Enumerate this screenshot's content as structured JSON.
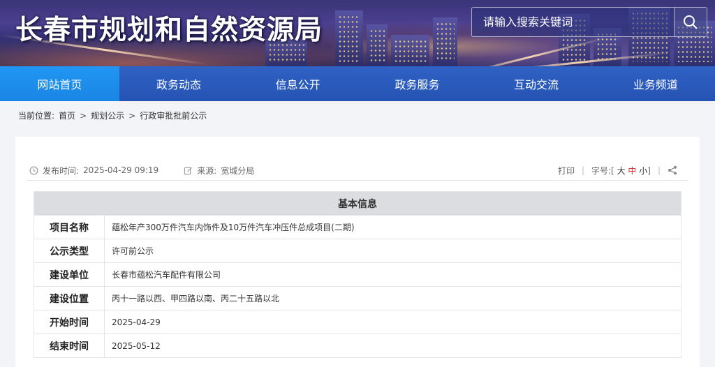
{
  "header": {
    "site_title": "长春市规划和自然资源局",
    "search_placeholder": "请输入搜索关键词"
  },
  "nav": {
    "items": [
      {
        "label": "网站首页"
      },
      {
        "label": "政务动态"
      },
      {
        "label": "信息公开"
      },
      {
        "label": "政务服务"
      },
      {
        "label": "互动交流"
      },
      {
        "label": "业务频道"
      }
    ],
    "active_index": 0
  },
  "breadcrumb": {
    "prefix": "当前位置:",
    "items": [
      "首页",
      "规划公示",
      "行政审批批前公示"
    ],
    "separator": ">"
  },
  "article_meta": {
    "publish_label": "发布时间:",
    "publish_time": "2025-04-29 09:19",
    "source_label": "来源:",
    "source": "宽城分局",
    "print_label": "打印",
    "font_size_label": "字号:",
    "font_size_open": "[",
    "font_size_close": "]",
    "font_sizes": [
      "大",
      "中",
      "小"
    ],
    "divider": "|"
  },
  "info_table": {
    "caption": "基本信息",
    "rows": [
      {
        "key": "项目名称",
        "value": "蕴松年产300万件汽车内饰件及10万件汽车冲压件总成项目(二期)"
      },
      {
        "key": "公示类型",
        "value": "许可前公示"
      },
      {
        "key": "建设单位",
        "value": "长春市蕴松汽车配件有限公司"
      },
      {
        "key": "建设位置",
        "value": "丙十一路以西、甲四路以南、丙二十五路以北"
      },
      {
        "key": "开始时间",
        "value": "2025-04-29"
      },
      {
        "key": "结束时间",
        "value": "2025-05-12"
      }
    ]
  },
  "colors": {
    "nav_bg": "#2553b3",
    "nav_active": "#1a85e4",
    "font_mid_highlight": "#d52a2a"
  },
  "icons": [
    "search-icon",
    "clock-icon",
    "edit-icon",
    "share-icon"
  ]
}
